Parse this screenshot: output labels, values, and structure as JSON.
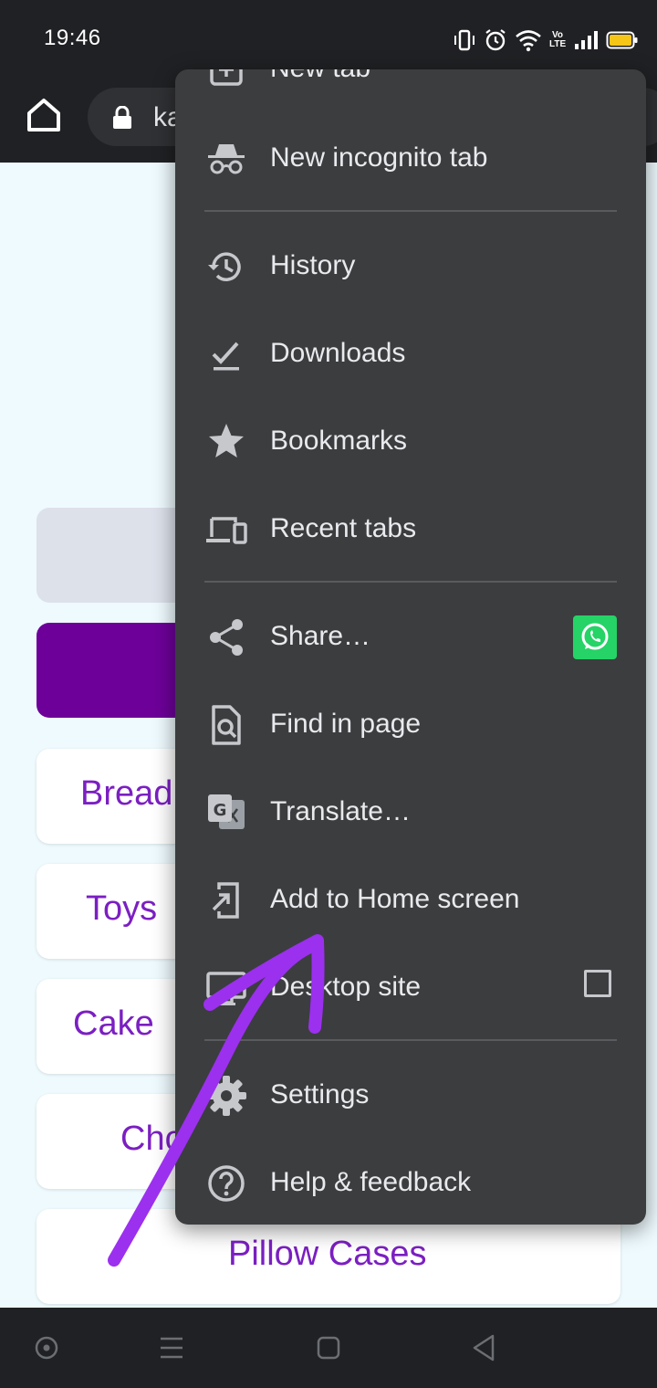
{
  "status_bar": {
    "time": "19:46",
    "network_label": "Vo LTE"
  },
  "toolbar": {
    "url_text": "ka"
  },
  "page": {
    "categories": [
      "Bread",
      "Toys",
      "Cake",
      "Cho",
      "Pillow Cases"
    ]
  },
  "menu": {
    "new_tab": "New tab",
    "new_incognito_tab": "New incognito tab",
    "history": "History",
    "downloads": "Downloads",
    "bookmarks": "Bookmarks",
    "recent_tabs": "Recent tabs",
    "share": "Share…",
    "find_in_page": "Find in page",
    "translate": "Translate…",
    "add_to_home_screen": "Add to Home screen",
    "desktop_site": "Desktop site",
    "settings": "Settings",
    "help_feedback": "Help & feedback"
  },
  "colors": {
    "menu_bg": "#3c3d3f",
    "accent_purple": "#6d0099",
    "annotation": "#9b30ef",
    "whatsapp": "#25d366"
  },
  "icons": [
    "home-icon",
    "lock-icon",
    "incognito-icon",
    "history-icon",
    "download-icon",
    "star-icon",
    "devices-icon",
    "share-icon",
    "whatsapp-icon",
    "find-in-page-icon",
    "translate-icon",
    "add-to-home-icon",
    "desktop-icon",
    "settings-gear-icon",
    "help-icon"
  ]
}
